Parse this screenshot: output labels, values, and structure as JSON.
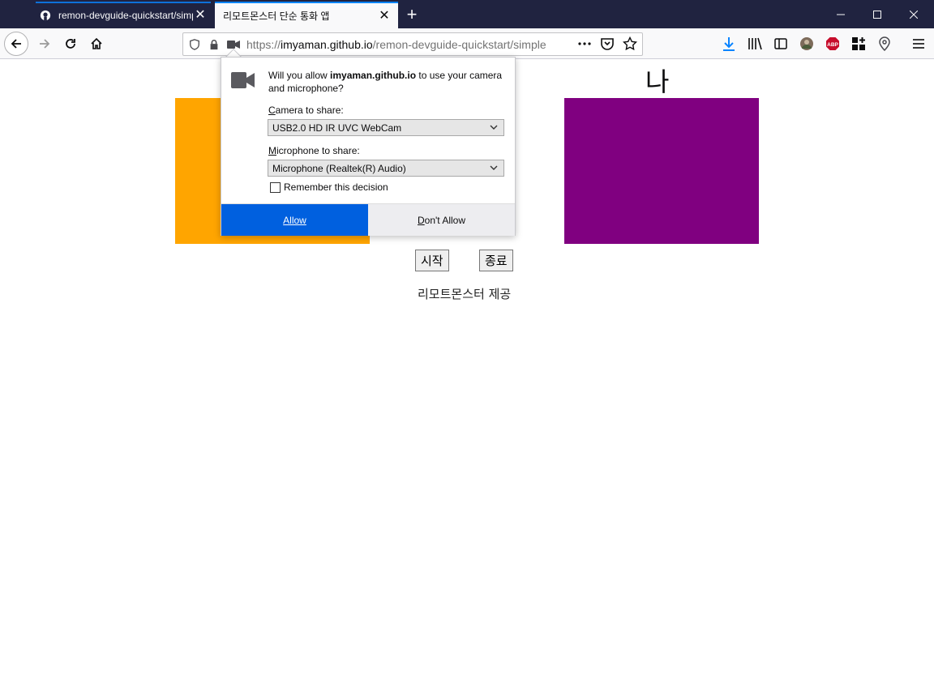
{
  "tabs": [
    {
      "title": "remon-devguide-quickstart/simple",
      "close": "✕"
    },
    {
      "title": "리모트몬스터 단순 통화 앱",
      "close": "✕"
    }
  ],
  "newtab": "+",
  "url": {
    "prefix": "https://",
    "host": "imyaman.github.io",
    "path": "/remon-devguide-quickstart/simple"
  },
  "page": {
    "heading_right": "나",
    "start_button": "시작",
    "stop_button": "종료",
    "footer": "리모트몬스터 제공",
    "colors": {
      "left_video": "#ffa500",
      "right_video": "#800080"
    }
  },
  "popup": {
    "msg_before": "Will you allow ",
    "msg_host": "imyaman.github.io",
    "msg_after": " to use your camera and microphone?",
    "camera_label_key": "C",
    "camera_label_rest": "amera to share:",
    "camera_value": "USB2.0 HD IR UVC WebCam",
    "mic_label_key": "M",
    "mic_label_rest": "icrophone to share:",
    "mic_value": "Microphone (Realtek(R) Audio)",
    "remember": "Remember this decision",
    "allow": "Allow",
    "deny_key": "D",
    "deny_rest": "on't Allow",
    "accent": "#0060df"
  },
  "icons": [
    "github-icon",
    "back-icon",
    "forward-icon",
    "reload-icon",
    "home-icon",
    "shield-icon",
    "lock-icon",
    "camera-icon",
    "more-icon",
    "pocket-icon",
    "star-icon",
    "download-icon",
    "library-icon",
    "sidebar-icon",
    "avatar",
    "abp-icon",
    "extensions-icon",
    "location-icon",
    "menu-icon"
  ]
}
